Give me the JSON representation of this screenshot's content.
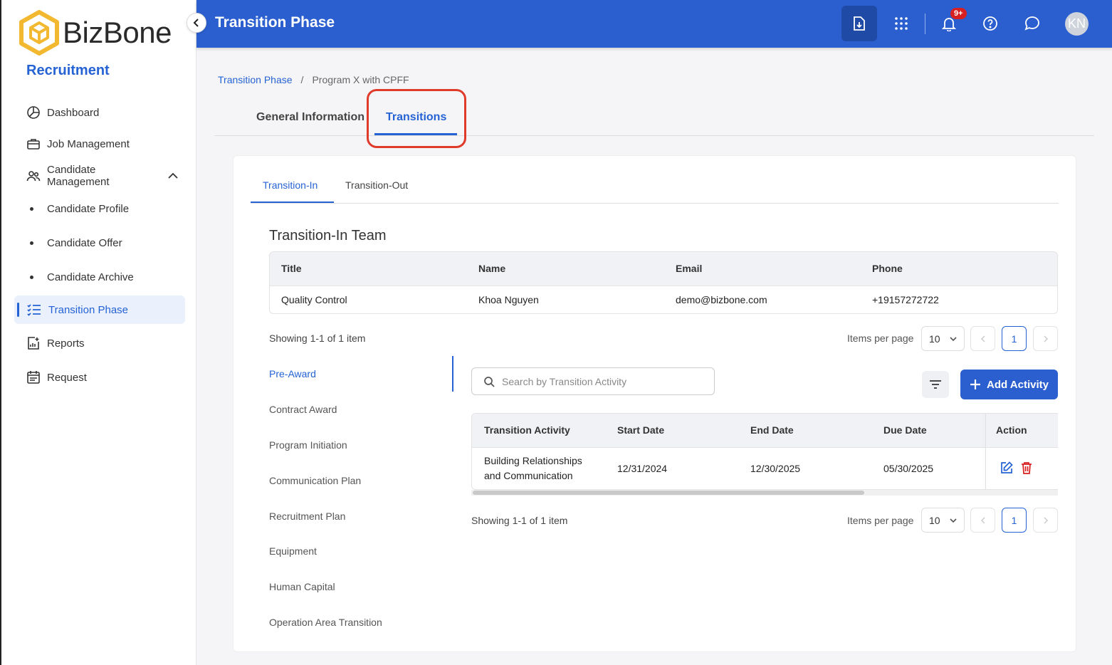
{
  "app": {
    "brand": "BizBone",
    "module": "Recruitment",
    "page_title": "Transition Phase",
    "notifications_badge": "9+",
    "user_initials": "KN",
    "colors": {
      "primary": "#2b5fcf",
      "accent": "#2563d4",
      "highlight": "#e03a2b",
      "logo": "#f2b830"
    }
  },
  "sidebar": {
    "items": [
      {
        "label": "Dashboard",
        "icon": "pie-chart-icon"
      },
      {
        "label": "Job Management",
        "icon": "briefcase-icon"
      },
      {
        "label": "Candidate Management",
        "icon": "users-icon"
      },
      {
        "label": "Transition Phase",
        "icon": "checklist-icon"
      },
      {
        "label": "Reports",
        "icon": "report-chart-icon"
      },
      {
        "label": "Request",
        "icon": "calendar-list-icon"
      }
    ],
    "subitems": [
      "Candidate Profile",
      "Candidate Offer",
      "Candidate Archive"
    ]
  },
  "breadcrumb": {
    "link": "Transition Phase",
    "sep": "/",
    "current": "Program X with CPFF"
  },
  "tabs": [
    "General Information",
    "Transitions"
  ],
  "subtabs": [
    "Transition-In",
    "Transition-Out"
  ],
  "team": {
    "title": "Transition-In Team",
    "headers": [
      "Title",
      "Name",
      "Email",
      "Phone"
    ],
    "row": [
      "Quality Control",
      "Khoa Nguyen",
      "demo@bizbone.com",
      "+19157272722"
    ],
    "showing": "Showing 1-1 of 1 item"
  },
  "pagination": {
    "items_per_page_label": "Items per page",
    "page_size": "10",
    "current_page": "1"
  },
  "phases": [
    "Pre-Award",
    "Contract Award",
    "Program Initiation",
    "Communication Plan",
    "Recruitment Plan",
    "Equipment",
    "Human Capital",
    "Operation Area Transition"
  ],
  "activities": {
    "search_placeholder": "Search by Transition Activity",
    "add_label": "Add Activity",
    "headers": [
      "Transition Activity",
      "Start Date",
      "End Date",
      "Due Date",
      "Action"
    ],
    "row": {
      "activity_line1": "Building Relationships",
      "activity_line2": "and Communication",
      "start": "12/31/2024",
      "end": "12/30/2025",
      "due": "05/30/2025"
    },
    "showing": "Showing 1-1 of 1 item"
  }
}
